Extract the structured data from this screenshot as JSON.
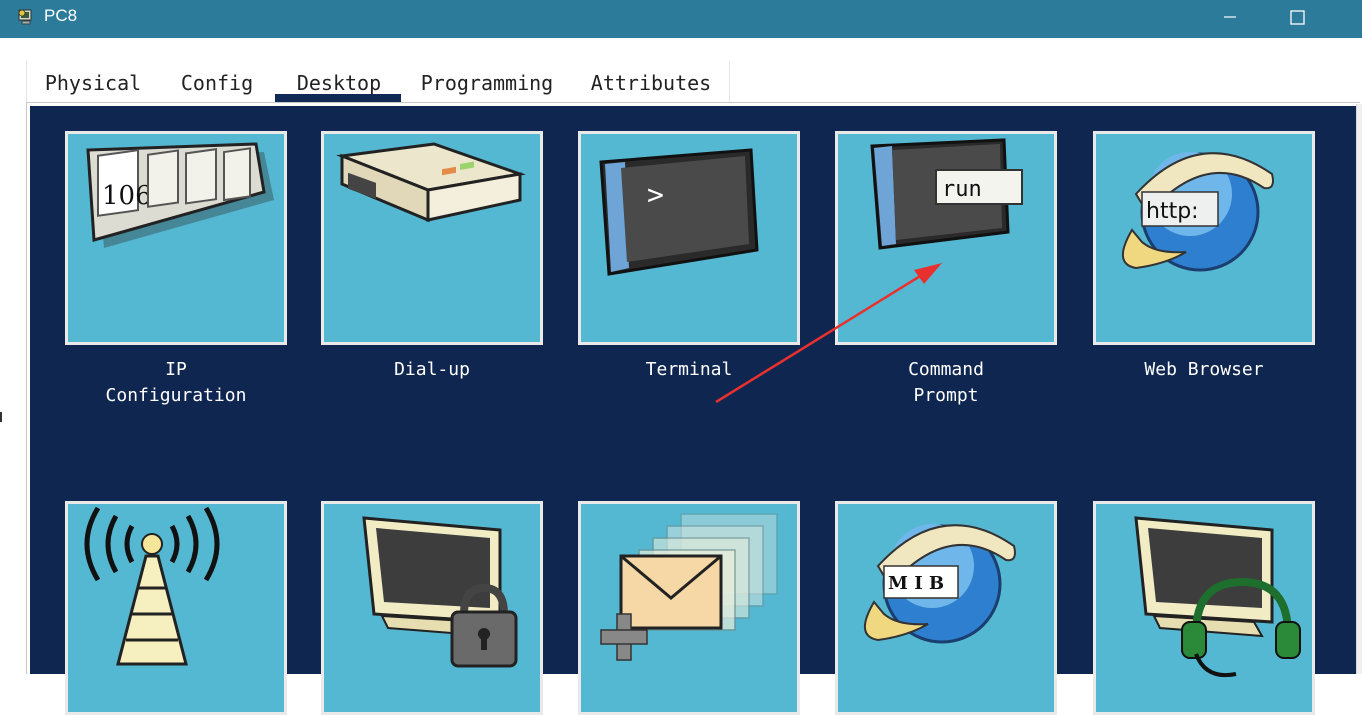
{
  "window": {
    "title": "PC8"
  },
  "tabs": [
    {
      "label": "Physical"
    },
    {
      "label": "Config"
    },
    {
      "label": "Desktop",
      "active": true
    },
    {
      "label": "Programming"
    },
    {
      "label": "Attributes"
    }
  ],
  "apps": [
    {
      "label1": "IP",
      "label2": "Configuration",
      "icon": "ip-configuration-icon",
      "icon_text": "106"
    },
    {
      "label1": "Dial-up",
      "label2": "",
      "icon": "dialup-modem-icon"
    },
    {
      "label1": "Terminal",
      "label2": "",
      "icon": "terminal-icon",
      "icon_text": ">"
    },
    {
      "label1": "Command",
      "label2": "Prompt",
      "icon": "command-prompt-icon",
      "icon_text": "run"
    },
    {
      "label1": "Web Browser",
      "label2": "",
      "icon": "web-browser-icon",
      "icon_text": "http:"
    },
    {
      "icon": "wireless-tower-icon"
    },
    {
      "icon": "monitor-lock-icon"
    },
    {
      "icon": "email-icon"
    },
    {
      "icon": "mib-browser-icon",
      "icon_text": "M I B"
    },
    {
      "icon": "monitor-headset-icon"
    }
  ],
  "colors": {
    "titlebar": "#2d7b9b",
    "desktop_bg": "#0f2650",
    "tile_bg": "#55b8d2",
    "annotation_arrow": "#e8302e"
  }
}
